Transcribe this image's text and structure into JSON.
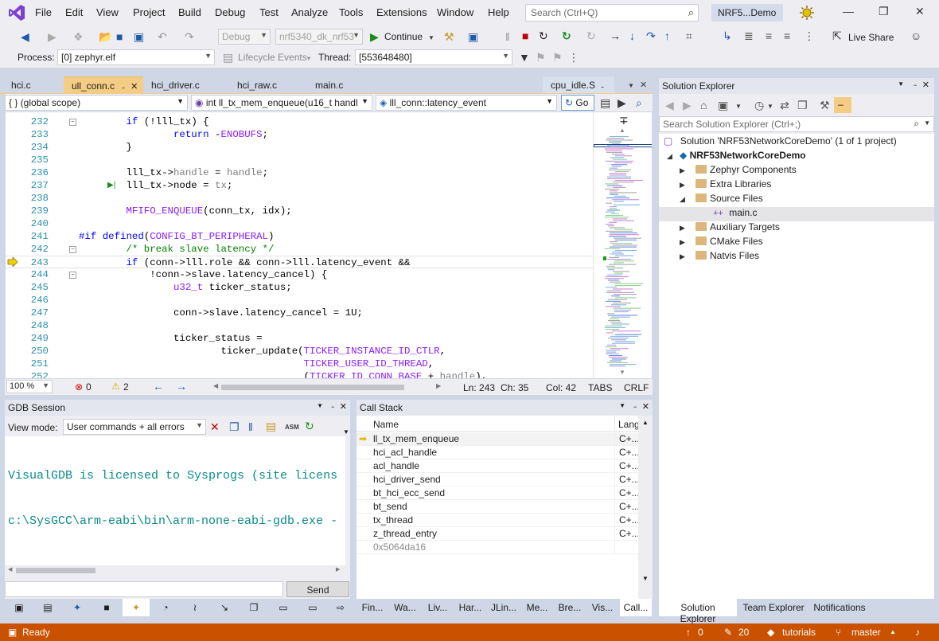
{
  "menubar": {
    "items": [
      "File",
      "Edit",
      "View",
      "Project",
      "Build",
      "Debug",
      "Test",
      "Analyze",
      "Tools",
      "Extensions",
      "Window",
      "Help"
    ],
    "search_placeholder": "Search (Ctrl+Q)",
    "app_title": "NRF5...Demo"
  },
  "toolbar": {
    "config": "Debug",
    "platform": "nrf5340_dk_nrf53",
    "continue_label": "Continue",
    "live_share": "Live Share",
    "process_label": "Process:",
    "process_value": "[0] zephyr.elf",
    "lifecycle_label": "Lifecycle Events",
    "thread_label": "Thread:",
    "thread_value": "[553648480]"
  },
  "doc_tabs": [
    "hci.c",
    "ull_conn.c",
    "hci_driver.c",
    "hci_raw.c",
    "main.c",
    "cpu_idle.S"
  ],
  "navbar": {
    "scope": "{ } (global scope)",
    "function": "int ll_tx_mem_enqueue(u16_t handl",
    "member": "lll_conn::latency_event",
    "go_label": "Go"
  },
  "editor": {
    "lines": [
      {
        "n": "232",
        "code": "        if (!lll_tx) {"
      },
      {
        "n": "233",
        "code": "                return -ENOBUFS;"
      },
      {
        "n": "234",
        "code": "        }"
      },
      {
        "n": "235",
        "code": ""
      },
      {
        "n": "236",
        "code": "        lll_tx->handle = handle;"
      },
      {
        "n": "237",
        "code": "        lll_tx->node = tx;"
      },
      {
        "n": "238",
        "code": ""
      },
      {
        "n": "239",
        "code": "        MFIFO_ENQUEUE(conn_tx, idx);"
      },
      {
        "n": "240",
        "code": ""
      },
      {
        "n": "241",
        "code": "#if defined(CONFIG_BT_PERIPHERAL)"
      },
      {
        "n": "242",
        "code": "        /* break slave latency */"
      },
      {
        "n": "243",
        "code": "        if (conn->lll.role && conn->lll.latency_event &&"
      },
      {
        "n": "244",
        "code": "            !conn->slave.latency_cancel) {"
      },
      {
        "n": "245",
        "code": "                u32_t ticker_status;"
      },
      {
        "n": "246",
        "code": ""
      },
      {
        "n": "247",
        "code": "                conn->slave.latency_cancel = 1U;"
      },
      {
        "n": "248",
        "code": ""
      },
      {
        "n": "249",
        "code": "                ticker_status ="
      },
      {
        "n": "250",
        "code": "                        ticker_update(TICKER_INSTANCE_ID_CTLR,"
      },
      {
        "n": "251",
        "code": "                                      TICKER_USER_ID_THREAD,"
      },
      {
        "n": "252",
        "code": "                                      (TICKER_ID_CONN_BASE + handle),"
      }
    ],
    "status": {
      "zoom": "100 %",
      "errors": "0",
      "warnings": "2",
      "ln": "Ln: 243",
      "ch": "Ch: 35",
      "col": "Col: 42",
      "tabs": "TABS",
      "eol": "CRLF"
    }
  },
  "gdb": {
    "title": "GDB Session",
    "view_mode_label": "View mode:",
    "view_mode_value": "User commands + all errors",
    "output": [
      "VisualGDB is licensed to Sysprogs (site licens",
      "c:\\SysGCC\\arm-eabi\\bin\\arm-none-eabi-gdb.exe -"
    ],
    "send_label": "Send"
  },
  "callstack": {
    "title": "Call Stack",
    "columns": [
      "Name",
      "Lang"
    ],
    "rows": [
      {
        "name": "ll_tx_mem_enqueue",
        "lang": "C+..."
      },
      {
        "name": "hci_acl_handle",
        "lang": "C+..."
      },
      {
        "name": "acl_handle",
        "lang": "C+..."
      },
      {
        "name": "hci_driver_send",
        "lang": "C+..."
      },
      {
        "name": "bt_hci_ecc_send",
        "lang": "C+..."
      },
      {
        "name": "bt_send",
        "lang": "C+..."
      },
      {
        "name": "tx_thread",
        "lang": "C+..."
      },
      {
        "name": "z_thread_entry",
        "lang": "C+..."
      },
      {
        "name": "0x5064da16",
        "lang": ""
      }
    ]
  },
  "bottom_tabs": [
    "Fin...",
    "Wa...",
    "Liv...",
    "Har...",
    "JLin...",
    "Me...",
    "Bre...",
    "Vis...",
    "Call..."
  ],
  "solution": {
    "title": "Solution Explorer",
    "search_placeholder": "Search Solution Explorer (Ctrl+;)",
    "solution_label": "Solution 'NRF53NetworkCoreDemo' (1 of 1 project)",
    "project": "NRF53NetworkCoreDemo",
    "items": [
      "Zephyr Components",
      "Extra Libraries",
      "Source Files",
      "main.c",
      "Auxiliary Targets",
      "CMake Files",
      "Natvis Files"
    ],
    "tabs": [
      "Solution Explorer",
      "Team Explorer",
      "Notifications"
    ]
  },
  "statusbar": {
    "ready": "Ready",
    "up_count": "0",
    "edit_count": "20",
    "repo": "tutorials",
    "branch": "master"
  }
}
